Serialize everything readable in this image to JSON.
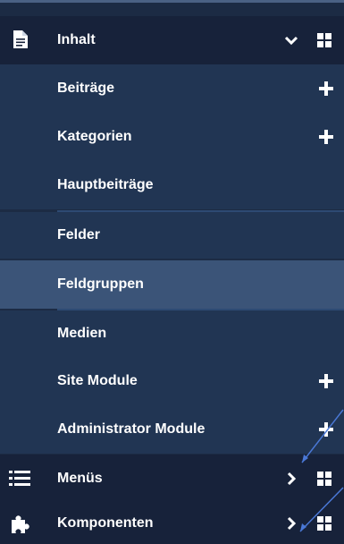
{
  "menu": {
    "content": {
      "label": "Inhalt",
      "icon": "document-icon",
      "items": [
        {
          "label": "Beiträge",
          "has_add": true
        },
        {
          "label": "Kategorien",
          "has_add": true
        },
        {
          "label": "Hauptbeiträge",
          "has_add": false
        },
        {
          "label": "Felder",
          "has_add": false
        },
        {
          "label": "Feldgruppen",
          "has_add": false,
          "active": true
        },
        {
          "label": "Medien",
          "has_add": false
        },
        {
          "label": "Site Module",
          "has_add": true
        },
        {
          "label": "Administrator Module",
          "has_add": true
        }
      ]
    },
    "menus": {
      "label": "Menüs",
      "icon": "list-icon"
    },
    "components": {
      "label": "Komponenten",
      "icon": "puzzle-icon"
    }
  },
  "colors": {
    "top_row": "#17223a",
    "sub_row": "#213553",
    "active_row": "#3b5478",
    "annotation_arrow": "#4a78d6"
  }
}
